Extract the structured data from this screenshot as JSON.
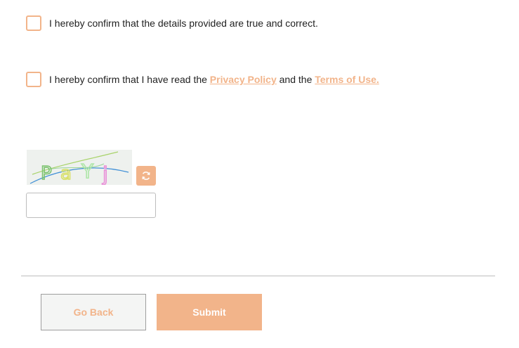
{
  "consent": {
    "truthful": {
      "text": "I hereby confirm that the details provided are true and correct."
    },
    "policy": {
      "text_before": "I hereby confirm that I have read the ",
      "privacy_link": "Privacy Policy",
      "text_middle": " and the ",
      "terms_link": "Terms of Use."
    }
  },
  "captcha": {
    "characters": [
      "P",
      "a",
      "Y",
      "j"
    ],
    "refresh_icon": "refresh-icon",
    "input_value": "",
    "input_placeholder": ""
  },
  "actions": {
    "back_label": "Go Back",
    "submit_label": "Submit"
  },
  "colors": {
    "accent": "#f2b48a",
    "border": "#bdbdbd"
  }
}
